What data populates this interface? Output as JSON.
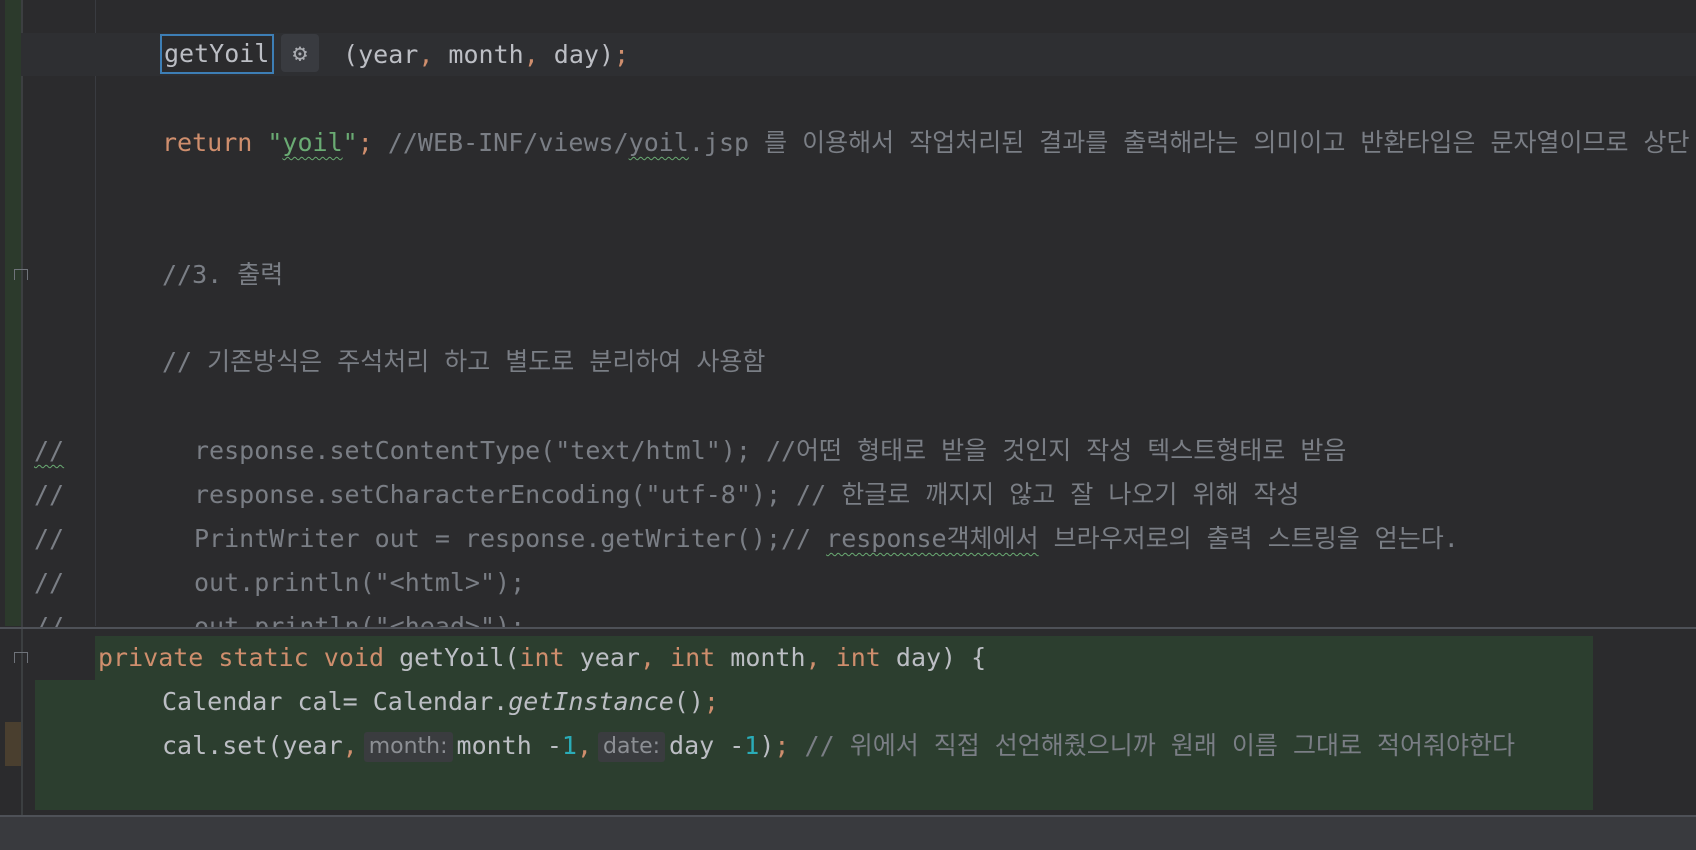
{
  "editor": {
    "rename_text": "getYoil",
    "rename_args": {
      "open": " (year",
      "comma1": ",",
      "month": " month",
      "comma2": ",",
      "close": " day)",
      "semi": ";"
    },
    "return_line": {
      "kw": "return",
      "str_open": " \"",
      "str_sq": "yoil",
      "str_close": "\"",
      "semi": ";",
      "comment_pre": " //WEB-INF/views/",
      "comment_sq": "yoil",
      "comment_post": ".jsp 를 이용해서 작업처리된 결과를 출력해라는 의미이고 반환타입은 문자열이므로 상단"
    },
    "comment_output": "//3. 출력",
    "comment_legacy": "// 기존방식은 주석처리 하고 별도로 분리하여 사용함",
    "commented_lines": [
      {
        "slash": "//",
        "code": "response.setContentType(\"text/html\"); //어떤 형태로 받을 것인지 작성 텍스트형태로 받음"
      },
      {
        "slash": "//",
        "code": "response.setCharacterEncoding(\"utf-8\"); // 한글로 깨지지 않고 잘 나오기 위해 작성"
      },
      {
        "slash": "//",
        "code_pre": "PrintWriter out = response.getWriter();// ",
        "code_sq": "response객체에서",
        "code_post": " 브라우저로의 출력 스트링을 얻는다."
      },
      {
        "slash": "//",
        "code": "out.println(\"<html>\");"
      },
      {
        "slash": "//",
        "code": "out.println(\"<head>\");"
      }
    ]
  },
  "preview": {
    "signature": {
      "private": "private",
      "static": "static",
      "void": "void",
      "name": "getYoil(",
      "int1": "int",
      "p1": "year",
      "c1": ",",
      "int2": "int",
      "p2": "month",
      "c2": ",",
      "int3": "int",
      "p3": "day)",
      "brace": "{"
    },
    "line2": {
      "pre": "Calendar cal= Calendar.",
      "method": "getInstance",
      "post": "()",
      "semi": ";"
    },
    "line3": {
      "pre": "cal.set(year",
      "comma": ",",
      "hint1": "month:",
      "arg1": "month -",
      "n1": "1",
      "comma2": ",",
      "hint2": "date:",
      "arg2": "day -",
      "n2": "1",
      "close": ")",
      "semi": ";",
      "comment": " // 위에서 직접 선언해줬으니까 원래 이름 그대로 적어줘야한다"
    }
  }
}
